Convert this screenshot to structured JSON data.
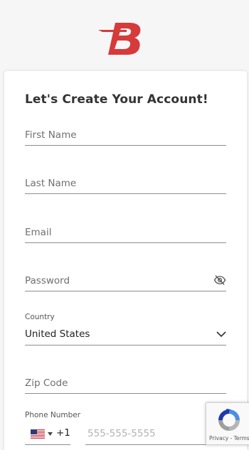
{
  "brand": {
    "logo_icon": "b-logo-icon",
    "color": "#d63a3a"
  },
  "form": {
    "title": "Let's Create Your Account!",
    "first_name": {
      "placeholder": "First Name",
      "value": ""
    },
    "last_name": {
      "placeholder": "Last Name",
      "value": ""
    },
    "email": {
      "placeholder": "Email",
      "value": ""
    },
    "password": {
      "placeholder": "Password",
      "value": "",
      "toggle_icon": "eye-slash-icon"
    },
    "country": {
      "label": "Country",
      "value": "United States",
      "icon": "chevron-down-icon"
    },
    "zip": {
      "placeholder": "Zip Code",
      "value": ""
    },
    "phone": {
      "label": "Phone Number",
      "flag_icon": "us-flag-icon",
      "dial_code": "+1",
      "placeholder": "555-555-5555",
      "value": ""
    }
  },
  "recaptcha": {
    "links": "Privacy - Terms",
    "icon": "recaptcha-icon"
  }
}
